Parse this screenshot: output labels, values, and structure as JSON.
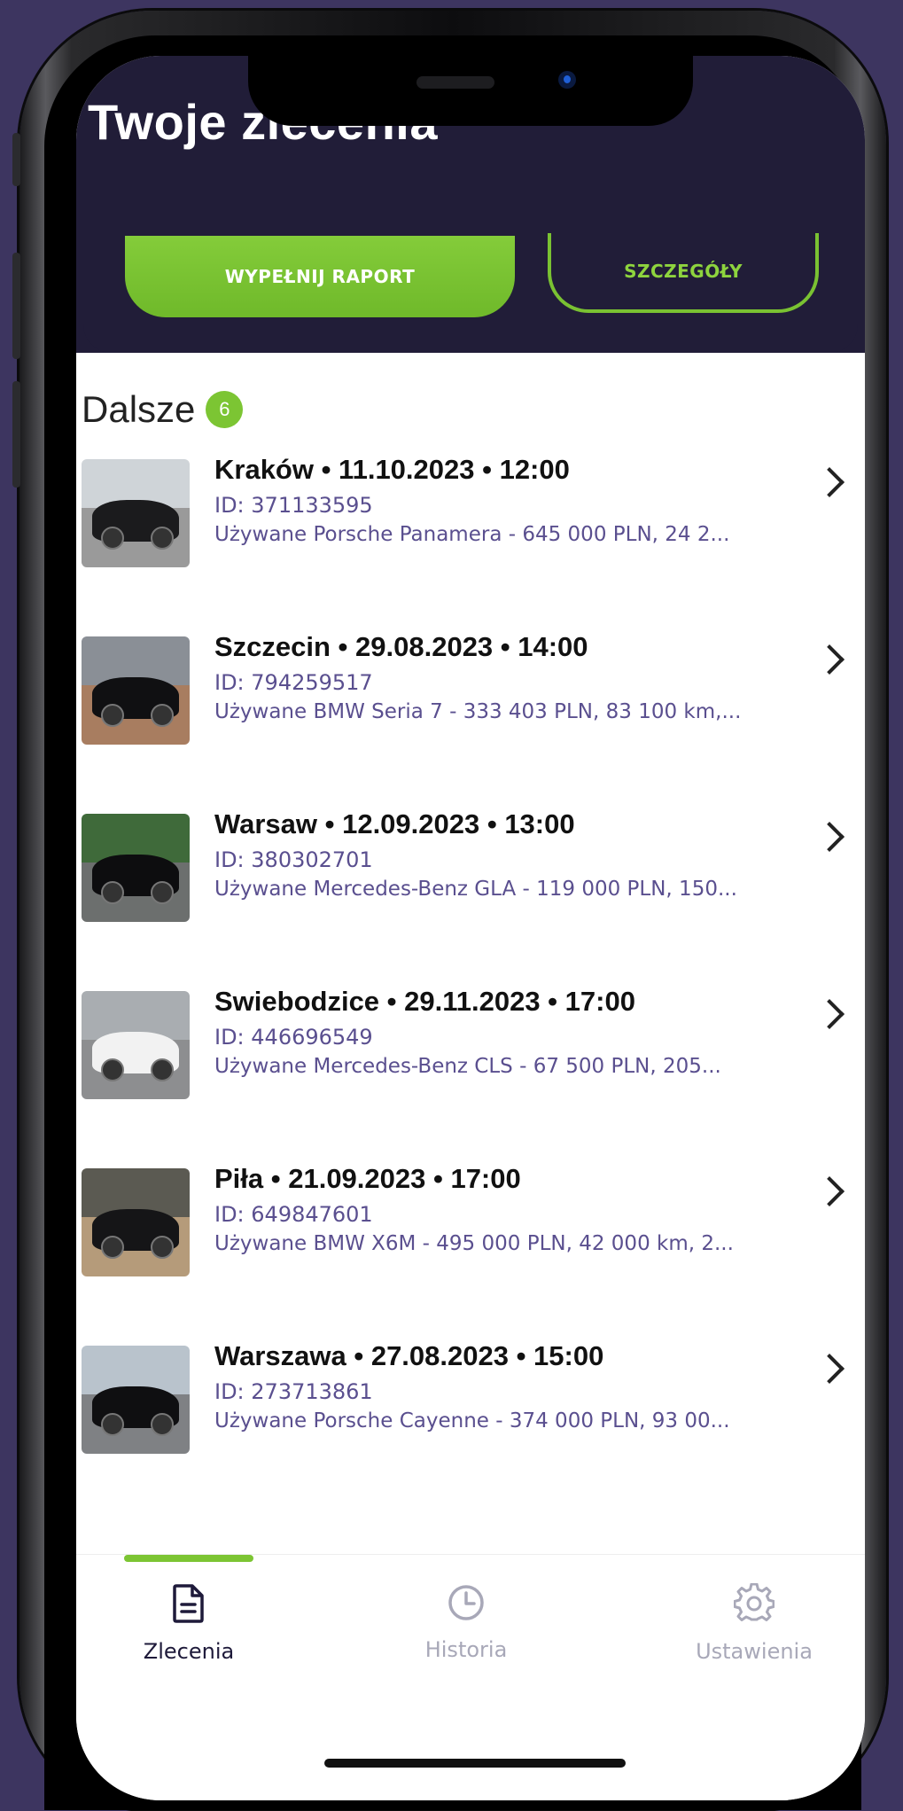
{
  "header": {
    "title": "Twoje zlecenia"
  },
  "actions": {
    "report_label": "WYPEŁNIJ RAPORT",
    "details_label": "SZCZEGÓŁY"
  },
  "section": {
    "title": "Dalsze",
    "count": "6"
  },
  "orders": [
    {
      "title": "Kraków • 11.10.2023 • 12:00",
      "id": "ID: 371133595",
      "desc": "Używane Porsche Panamera - 645 000 PLN, 24 2..."
    },
    {
      "title": "Szczecin • 29.08.2023 • 14:00",
      "id": "ID: 794259517",
      "desc": "Używane BMW Seria 7 - 333 403 PLN, 83 100 km,..."
    },
    {
      "title": "Warsaw • 12.09.2023 • 13:00",
      "id": "ID: 380302701",
      "desc": "Używane Mercedes-Benz GLA - 119 000 PLN, 150..."
    },
    {
      "title": "Swiebodzice • 29.11.2023 • 17:00",
      "id": "ID: 446696549",
      "desc": "Używane Mercedes-Benz CLS - 67 500 PLN, 205..."
    },
    {
      "title": "Piła • 21.09.2023 • 17:00",
      "id": "ID: 649847601",
      "desc": "Używane BMW X6M - 495 000 PLN, 42 000 km, 2..."
    },
    {
      "title": "Warszawa • 27.08.2023 • 15:00",
      "id": "ID: 273713861",
      "desc": "Używane Porsche Cayenne - 374 000 PLN, 93 00..."
    }
  ],
  "tabbar": {
    "tabs": [
      {
        "label": "Zlecenia",
        "icon": "document-icon",
        "active": true
      },
      {
        "label": "Historia",
        "icon": "clock-icon",
        "active": false
      },
      {
        "label": "Ustawienia",
        "icon": "gear-icon",
        "active": false
      }
    ]
  },
  "colors": {
    "accent": "#7cc533",
    "header_bg": "#211d38",
    "secondary_text": "#5a4f8f"
  }
}
